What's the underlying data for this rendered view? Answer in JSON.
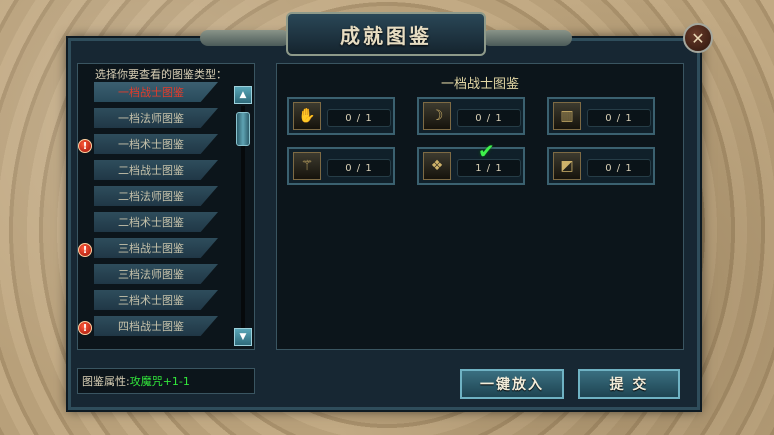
{
  "window": {
    "title": "成就图鉴",
    "close_glyph": "✕"
  },
  "left": {
    "hint": "选择你要查看的图鉴类型：",
    "items": [
      {
        "label": "一档战士图鉴",
        "selected": true,
        "alert": false
      },
      {
        "label": "一档法师图鉴",
        "selected": false,
        "alert": false
      },
      {
        "label": "一档术士图鉴",
        "selected": false,
        "alert": true
      },
      {
        "label": "二档战士图鉴",
        "selected": false,
        "alert": false
      },
      {
        "label": "二档法师图鉴",
        "selected": false,
        "alert": false
      },
      {
        "label": "二档术士图鉴",
        "selected": false,
        "alert": false
      },
      {
        "label": "三档战士图鉴",
        "selected": false,
        "alert": true
      },
      {
        "label": "三档法师图鉴",
        "selected": false,
        "alert": false
      },
      {
        "label": "三档术士图鉴",
        "selected": false,
        "alert": false
      },
      {
        "label": "四档战士图鉴",
        "selected": false,
        "alert": true
      }
    ],
    "alert_glyph": "!",
    "scroll_up": "▲",
    "scroll_down": "▼"
  },
  "attr": {
    "label": "图鉴属性:",
    "value": "攻魔咒+1-1"
  },
  "main": {
    "section_title": "一档战士图鉴",
    "slots": [
      {
        "icon": "glove-icon",
        "glyph": "✋",
        "count": "0 / 1",
        "completed": false
      },
      {
        "icon": "horn-icon",
        "glyph": "☽",
        "count": "0 / 1",
        "completed": false
      },
      {
        "icon": "bracer-icon",
        "glyph": "▥",
        "count": "0 / 1",
        "completed": false
      },
      {
        "icon": "staff-icon",
        "glyph": "⚚",
        "count": "0 / 1",
        "completed": false
      },
      {
        "icon": "belt-icon",
        "glyph": "❖",
        "count": "1 / 1",
        "completed": true
      },
      {
        "icon": "boots-icon",
        "glyph": "◩",
        "count": "0 / 1",
        "completed": false
      }
    ],
    "check_glyph": "✔"
  },
  "buttons": {
    "auto_place": "一键放入",
    "submit": "提 交"
  }
}
